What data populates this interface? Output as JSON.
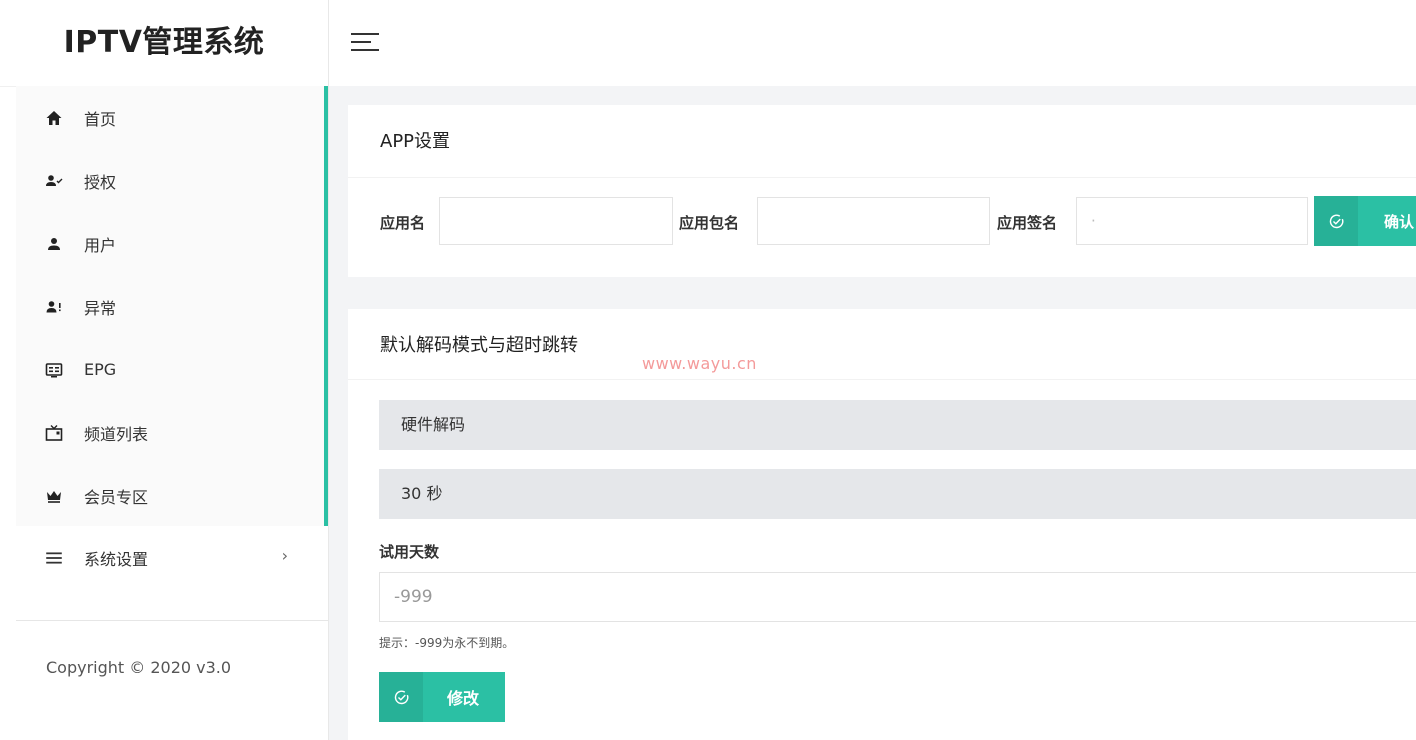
{
  "app": {
    "title": "IPTV管理系统"
  },
  "sidebar": {
    "items": [
      {
        "label": "首页",
        "icon": "home-icon"
      },
      {
        "label": "授权",
        "icon": "user-check-icon"
      },
      {
        "label": "用户",
        "icon": "user-icon"
      },
      {
        "label": "异常",
        "icon": "user-alert-icon"
      },
      {
        "label": "EPG",
        "icon": "tv-guide-icon"
      },
      {
        "label": "频道列表",
        "icon": "tv-icon"
      },
      {
        "label": "会员专区",
        "icon": "crown-icon"
      }
    ],
    "settings": {
      "label": "系统设置",
      "icon": "menu-lines-icon",
      "chevron": "›"
    },
    "copyright": "Copyright © 2020 v3.0"
  },
  "app_settings": {
    "title": "APP设置",
    "app_name_label": "应用名",
    "app_name_value": "",
    "package_label": "应用包名",
    "package_value": "",
    "signature_label": "应用签名",
    "signature_value": "·",
    "confirm_label": "确认"
  },
  "decode_settings": {
    "title": "默认解码模式与超时跳转",
    "watermark": "www.wayu.cn",
    "decode_mode": "硬件解码",
    "timeout": "30 秒",
    "trial_label": "试用天数",
    "trial_value": "-999",
    "hint": "提示：-999为永不到期。",
    "modify_label": "修改"
  },
  "colors": {
    "accent": "#2bc0a4",
    "watermark": "#f49a9a"
  }
}
